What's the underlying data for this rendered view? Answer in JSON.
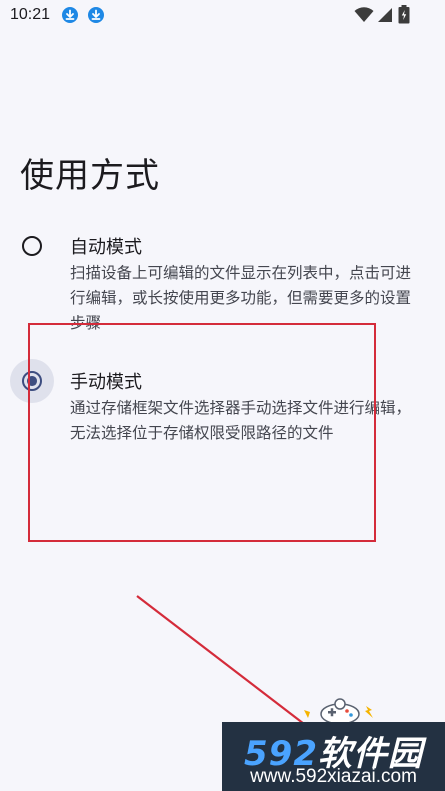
{
  "status_bar": {
    "time": "10:21"
  },
  "page": {
    "title": "使用方式"
  },
  "options": [
    {
      "title": "自动模式",
      "description": "扫描设备上可编辑的文件显示在列表中，点击可进行编辑，或长按使用更多功能，但需要更多的设置步骤",
      "selected": false
    },
    {
      "title": "手动模式",
      "description": "通过存储框架文件选择器手动选择文件进行编辑，无法选择位于存储权限受限路径的文件",
      "selected": true
    }
  ],
  "watermark": {
    "digits": "592",
    "brand": "软件园",
    "url": "www.592xiazai.com"
  },
  "colors": {
    "accent": "#3d4d80",
    "annotation_red": "#d42b3a",
    "download_icon": "#1e88e5",
    "background": "#f6f6fb"
  }
}
